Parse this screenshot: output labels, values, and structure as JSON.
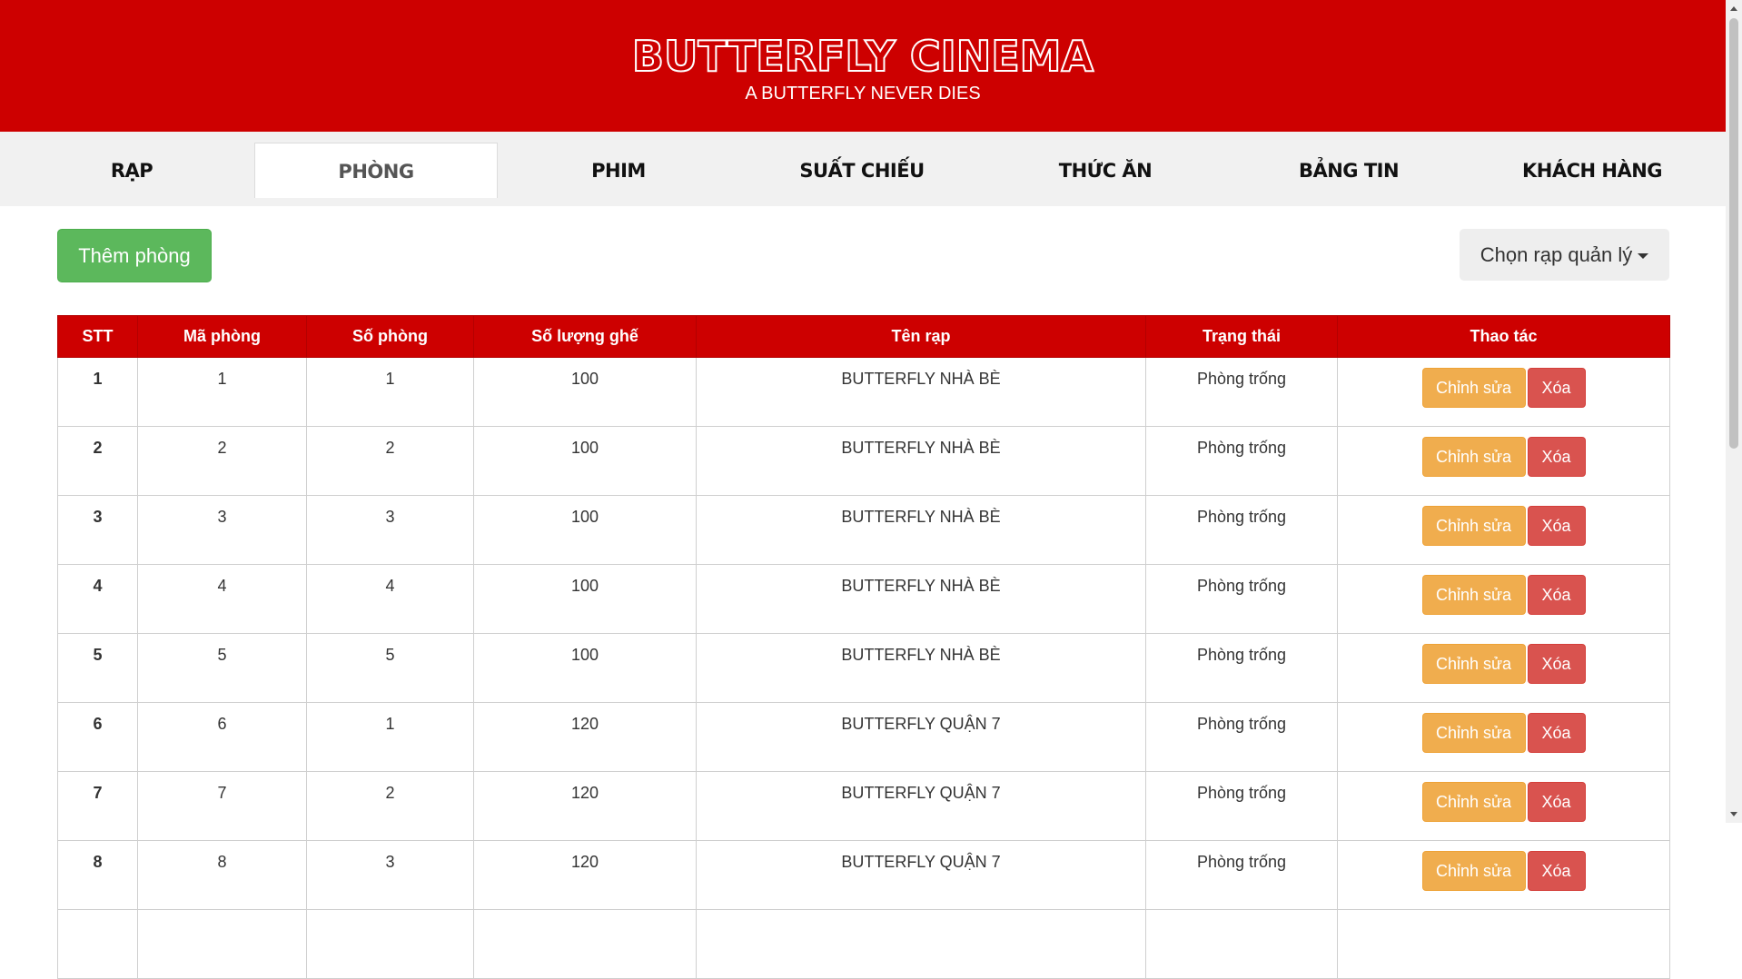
{
  "header": {
    "brand": "BUTTERFLY CINEMA",
    "tagline": "A BUTTERFLY NEVER DIES"
  },
  "nav": {
    "items": [
      {
        "label": "RẠP"
      },
      {
        "label": "PHÒNG"
      },
      {
        "label": "PHIM"
      },
      {
        "label": "SUẤT CHIẾU"
      },
      {
        "label": "THỨC ĂN"
      },
      {
        "label": "BẢNG TIN"
      },
      {
        "label": "KHÁCH HÀNG"
      }
    ],
    "active": "PHÒNG"
  },
  "toolbar": {
    "add_label": "Thêm phòng",
    "select_label": "Chọn rạp quản lý"
  },
  "table": {
    "headers": [
      "STT",
      "Mã phòng",
      "Số phòng",
      "Số lượng ghế",
      "Tên rạp",
      "Trạng thái",
      "Thao tác"
    ],
    "edit_label": "Chỉnh sửa",
    "delete_label": "Xóa",
    "rows": [
      {
        "stt": "1",
        "ma": "1",
        "so": "1",
        "ghe": "100",
        "rap": "BUTTERFLY NHÀ BÈ",
        "trang_thai": "Phòng trống"
      },
      {
        "stt": "2",
        "ma": "2",
        "so": "2",
        "ghe": "100",
        "rap": "BUTTERFLY NHÀ BÈ",
        "trang_thai": "Phòng trống"
      },
      {
        "stt": "3",
        "ma": "3",
        "so": "3",
        "ghe": "100",
        "rap": "BUTTERFLY NHÀ BÈ",
        "trang_thai": "Phòng trống"
      },
      {
        "stt": "4",
        "ma": "4",
        "so": "4",
        "ghe": "100",
        "rap": "BUTTERFLY NHÀ BÈ",
        "trang_thai": "Phòng trống"
      },
      {
        "stt": "5",
        "ma": "5",
        "so": "5",
        "ghe": "100",
        "rap": "BUTTERFLY NHÀ BÈ",
        "trang_thai": "Phòng trống"
      },
      {
        "stt": "6",
        "ma": "6",
        "so": "1",
        "ghe": "120",
        "rap": "BUTTERFLY QUẬN 7",
        "trang_thai": "Phòng trống"
      },
      {
        "stt": "7",
        "ma": "7",
        "so": "2",
        "ghe": "120",
        "rap": "BUTTERFLY QUẬN 7",
        "trang_thai": "Phòng trống"
      },
      {
        "stt": "8",
        "ma": "8",
        "so": "3",
        "ghe": "120",
        "rap": "BUTTERFLY QUẬN 7",
        "trang_thai": "Phòng trống"
      },
      {
        "stt": "",
        "ma": "",
        "so": "",
        "ghe": "",
        "rap": "",
        "trang_thai": ""
      }
    ]
  },
  "colors": {
    "brand_red": "#cd0000",
    "success": "#5cb85c",
    "warning": "#f0ad4e",
    "danger": "#d9534f"
  }
}
